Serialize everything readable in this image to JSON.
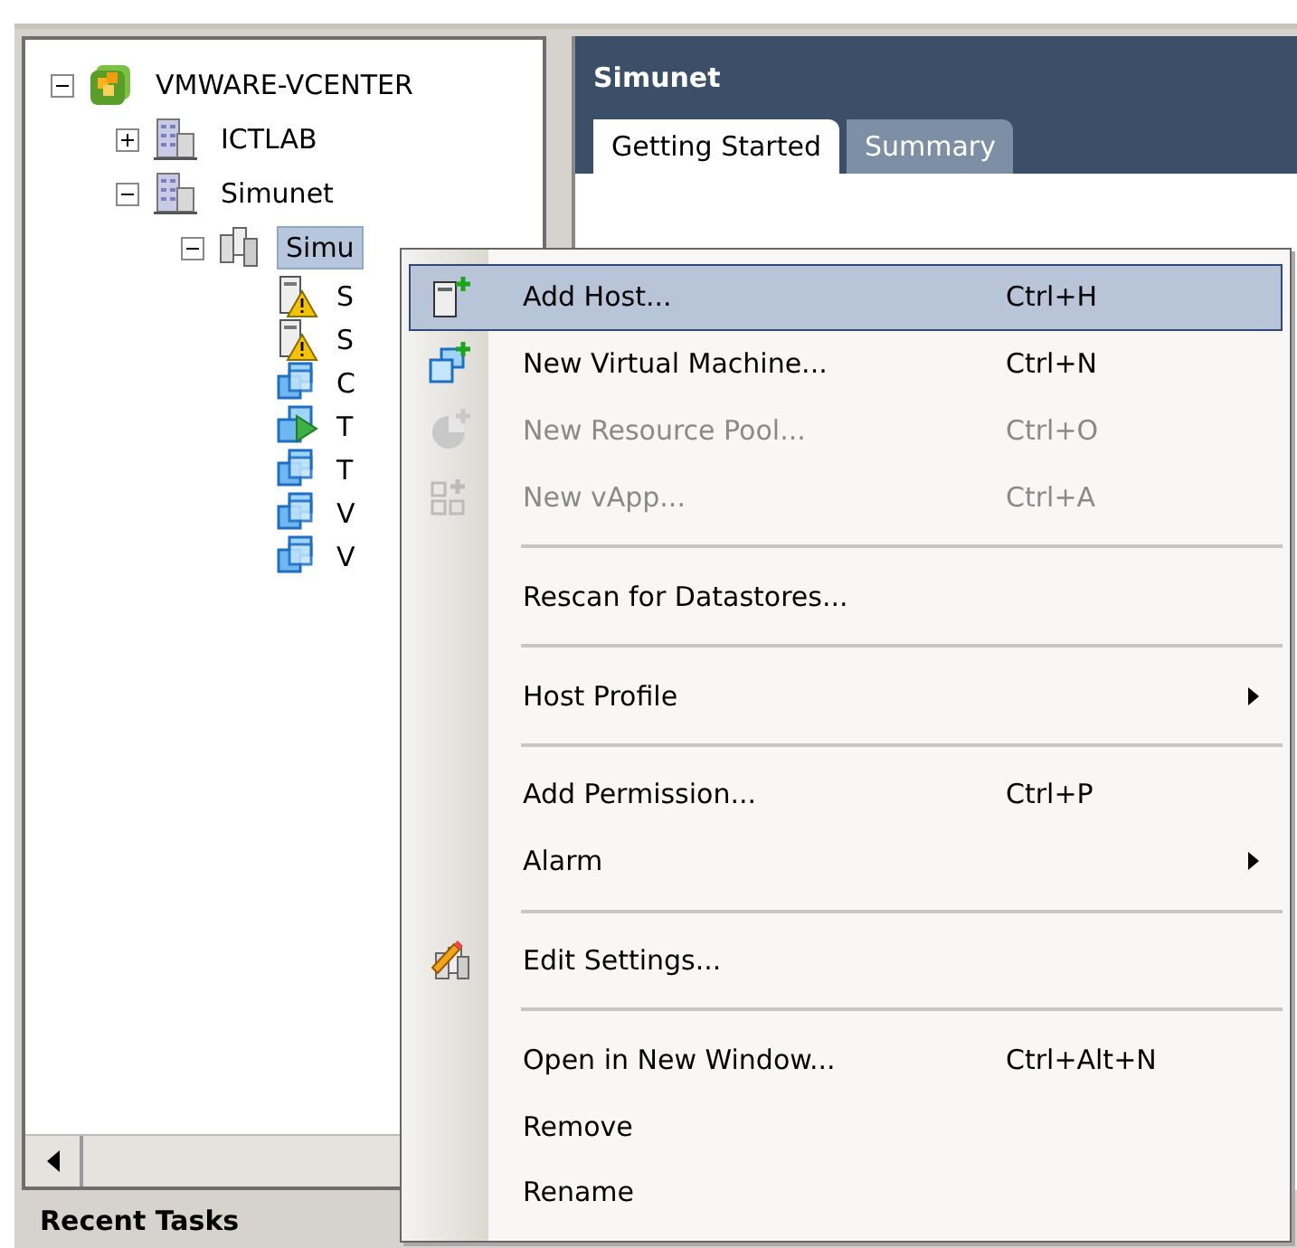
{
  "tree": [
    {
      "label": "VMWARE-VCENTER",
      "kind": "vcenter",
      "expanded": true,
      "selected": false,
      "children": [
        {
          "label": "ICTLAB",
          "kind": "datacenter",
          "expanded": false,
          "selected": false
        },
        {
          "label": "Simunet",
          "kind": "datacenter",
          "expanded": true,
          "selected": false,
          "children": [
            {
              "label": "Simu",
              "kind": "cluster",
              "expanded": true,
              "selected": true,
              "children": [
                {
                  "label": "S",
                  "kind": "host-warning",
                  "selected": false
                },
                {
                  "label": "S",
                  "kind": "host-warning",
                  "selected": false
                },
                {
                  "label": "C",
                  "kind": "vm",
                  "selected": false
                },
                {
                  "label": "T",
                  "kind": "vm-running",
                  "selected": false
                },
                {
                  "label": "T",
                  "kind": "vm",
                  "selected": false
                },
                {
                  "label": "V",
                  "kind": "vm",
                  "selected": false
                },
                {
                  "label": "V",
                  "kind": "vm",
                  "selected": false
                }
              ]
            }
          ]
        }
      ]
    }
  ],
  "panel": {
    "title": "Simunet",
    "tabs": [
      {
        "label": "Getting Started",
        "selected": true
      },
      {
        "label": "Summary",
        "selected": false
      }
    ]
  },
  "context_menu": [
    {
      "kind": "add-host",
      "label": "Add Host...",
      "shortcut": "Ctrl+H",
      "selected": true,
      "disabled": false,
      "submenu": false
    },
    {
      "kind": "new-vm",
      "label": "New Virtual Machine...",
      "shortcut": "Ctrl+N",
      "selected": false,
      "disabled": false,
      "submenu": false
    },
    {
      "kind": "resource-pool",
      "label": "New Resource Pool...",
      "shortcut": "Ctrl+O",
      "selected": false,
      "disabled": true,
      "submenu": false
    },
    {
      "kind": "vapp",
      "label": "New vApp...",
      "shortcut": "Ctrl+A",
      "selected": false,
      "disabled": true,
      "submenu": false
    },
    {
      "kind": "separator"
    },
    {
      "kind": "plain",
      "label": "Rescan for Datastores...",
      "selected": false,
      "disabled": false,
      "submenu": false
    },
    {
      "kind": "separator"
    },
    {
      "kind": "plain",
      "label": "Host Profile",
      "selected": false,
      "disabled": false,
      "submenu": true
    },
    {
      "kind": "separator"
    },
    {
      "kind": "plain",
      "label": "Add Permission...",
      "shortcut": "Ctrl+P",
      "selected": false,
      "disabled": false,
      "submenu": false
    },
    {
      "kind": "plain",
      "label": "Alarm",
      "selected": false,
      "disabled": false,
      "submenu": true
    },
    {
      "kind": "separator"
    },
    {
      "kind": "edit-settings",
      "label": "Edit Settings...",
      "selected": false,
      "disabled": false,
      "submenu": false
    },
    {
      "kind": "separator"
    },
    {
      "kind": "plain",
      "label": "Open in New Window...",
      "shortcut": "Ctrl+Alt+N",
      "selected": false,
      "disabled": false,
      "submenu": false
    },
    {
      "kind": "plain",
      "label": "Remove",
      "selected": false,
      "disabled": false,
      "submenu": false
    },
    {
      "kind": "plain",
      "label": "Rename",
      "selected": false,
      "disabled": false,
      "submenu": false
    }
  ],
  "bottom_pane": {
    "title": "Recent Tasks"
  }
}
